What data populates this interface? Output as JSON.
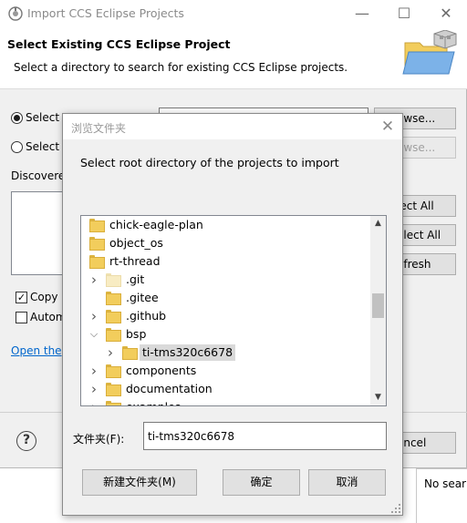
{
  "parent_window": {
    "title": "Import CCS Eclipse Projects",
    "minimize": "—",
    "maximize": "☐",
    "close": "✕",
    "header_title": "Select Existing CCS Eclipse Project",
    "header_desc": "Select a directory to search for existing CCS Eclipse projects.",
    "radio_1_label": "Select s",
    "radio_2_label": "Select a",
    "discovered_label": "Discovere",
    "browse_button_1": "owse...",
    "browse_button_2": "owse...",
    "select_all_button": "lect All",
    "deselect_all_button": "elect All",
    "refresh_button": "efresh",
    "copy_checkbox_label": "Copy p",
    "auto_checkbox_label": "Autom",
    "open_link": "Open the",
    "help_icon": "?",
    "cancel_button": "ancel",
    "no_search_text": "No sear"
  },
  "dialog": {
    "title": "浏览文件夹",
    "close": "✕",
    "instruction": "Select root directory of the projects to import",
    "tree": [
      {
        "name": "chick-eagle-plan",
        "level": 0,
        "chevron": "right",
        "selected": false,
        "light": false
      },
      {
        "name": "object_os",
        "level": 0,
        "chevron": "right",
        "selected": false,
        "light": false
      },
      {
        "name": "rt-thread",
        "level": 0,
        "chevron": "down",
        "selected": false,
        "light": false
      },
      {
        "name": ".git",
        "level": 1,
        "chevron": "right",
        "selected": false,
        "light": true
      },
      {
        "name": ".gitee",
        "level": 1,
        "chevron": "none",
        "selected": false,
        "light": false
      },
      {
        "name": ".github",
        "level": 1,
        "chevron": "right",
        "selected": false,
        "light": false
      },
      {
        "name": "bsp",
        "level": 1,
        "chevron": "down",
        "selected": false,
        "light": false
      },
      {
        "name": "ti-tms320c6678",
        "level": 2,
        "chevron": "right",
        "selected": true,
        "light": false
      },
      {
        "name": "components",
        "level": 1,
        "chevron": "right",
        "selected": false,
        "light": false
      },
      {
        "name": "documentation",
        "level": 1,
        "chevron": "right",
        "selected": false,
        "light": false
      },
      {
        "name": "examples",
        "level": 1,
        "chevron": "right",
        "selected": false,
        "light": false
      }
    ],
    "scroll_up": "▲",
    "scroll_down": "▼",
    "folder_label": "文件夹(F):",
    "folder_value": "ti-tms320c6678",
    "new_folder_button": "新建文件夹(M)",
    "ok_button": "确定",
    "cancel_button": "取消"
  },
  "colors": {
    "window_bg": "#f0f0f0",
    "folder": "#f2cd5c",
    "link": "#0066cc",
    "selection": "#d9d9d9"
  }
}
